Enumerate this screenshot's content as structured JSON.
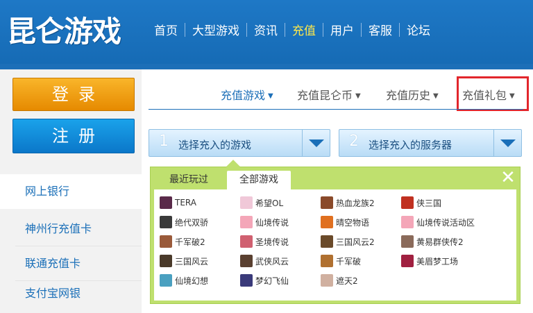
{
  "header": {
    "logo": "昆仑游戏",
    "nav": [
      {
        "label": "首页",
        "active": false
      },
      {
        "label": "大型游戏",
        "active": false
      },
      {
        "label": "资讯",
        "active": false
      },
      {
        "label": "充值",
        "active": true
      },
      {
        "label": "用户",
        "active": false
      },
      {
        "label": "客服",
        "active": false
      },
      {
        "label": "论坛",
        "active": false
      }
    ]
  },
  "sidebar": {
    "login": "登录",
    "register": "注册",
    "items": [
      "网上银行",
      "神州行充值卡",
      "联通充值卡",
      "支付宝网银"
    ]
  },
  "tabs": [
    {
      "label": "充值游戏",
      "active": true
    },
    {
      "label": "充值昆仑币",
      "active": false
    },
    {
      "label": "充值历史",
      "active": false
    },
    {
      "label": "充值礼包",
      "active": false
    }
  ],
  "selects": [
    {
      "num": "1",
      "label": "选择充入的游戏"
    },
    {
      "num": "2",
      "label": "选择充入的服务器"
    }
  ],
  "panel": {
    "tabs": [
      "最近玩过",
      "全部游戏"
    ],
    "close": "✕",
    "games": [
      {
        "name": "TERA",
        "color": "#5a2a4a"
      },
      {
        "name": "希望OL",
        "color": "#f0c8d8"
      },
      {
        "name": "热血龙族2",
        "color": "#8a4a2a"
      },
      {
        "name": "侠三国",
        "color": "#c03020"
      },
      {
        "name": "绝代双骄",
        "color": "#3a3a3a"
      },
      {
        "name": "仙境传说",
        "color": "#f4a6b8"
      },
      {
        "name": "晴空物语",
        "color": "#e07020"
      },
      {
        "name": "仙境传说活动区",
        "color": "#f4a6b8"
      },
      {
        "name": "千军破2",
        "color": "#9a5a3a"
      },
      {
        "name": "圣境传说",
        "color": "#d06070"
      },
      {
        "name": "三国风云2",
        "color": "#6a4a2a"
      },
      {
        "name": "黄易群侠传2",
        "color": "#8a6a5a"
      },
      {
        "name": "三国风云",
        "color": "#4a3a2a"
      },
      {
        "name": "武侠风云",
        "color": "#5a4030"
      },
      {
        "name": "千军破",
        "color": "#b07030"
      },
      {
        "name": "美眉梦工场",
        "color": "#a02040"
      },
      {
        "name": "仙境幻想",
        "color": "#4aa0c0"
      },
      {
        "name": "梦幻飞仙",
        "color": "#3a3a7a"
      },
      {
        "name": "遮天2",
        "color": "#d0b0a0"
      }
    ]
  }
}
